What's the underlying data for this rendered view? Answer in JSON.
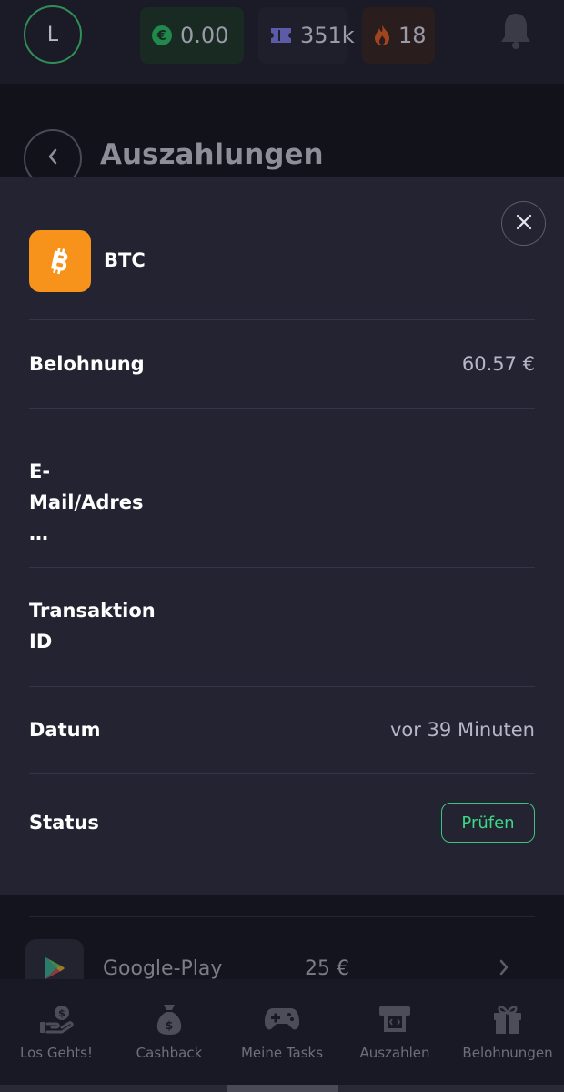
{
  "topbar": {
    "avatar_initial": "L",
    "balance": "0.00",
    "tickets": "351k",
    "streak": "18",
    "icons": [
      "euro-icon",
      "ticket-icon",
      "flame-icon",
      "bell-icon"
    ]
  },
  "page": {
    "title": "Auszahlungen"
  },
  "detail": {
    "coin": "BTC",
    "rows": {
      "reward_label": "Belohnung",
      "reward_value": "60.57 €",
      "email_label": "E-Mail/Adres…",
      "txid_label": "Transaktion ID",
      "date_label": "Datum",
      "date_value": "vor 39 Minuten",
      "status_label": "Status",
      "status_value": "Prüfen"
    }
  },
  "background_list": {
    "item_name": "Google-Play",
    "item_price": "25 €"
  },
  "bottom_nav": [
    {
      "label": "Los Gehts!",
      "icon": "hand-coin-icon"
    },
    {
      "label": "Cashback",
      "icon": "money-bag-icon"
    },
    {
      "label": "Meine Tasks",
      "icon": "gamepad-icon"
    },
    {
      "label": "Auszahlen",
      "icon": "withdraw-icon"
    },
    {
      "label": "Belohnungen",
      "icon": "gift-icon"
    }
  ],
  "colors": {
    "accent_green": "#3cd886",
    "btc_orange": "#f7931a",
    "sheet_bg": "#232332"
  }
}
